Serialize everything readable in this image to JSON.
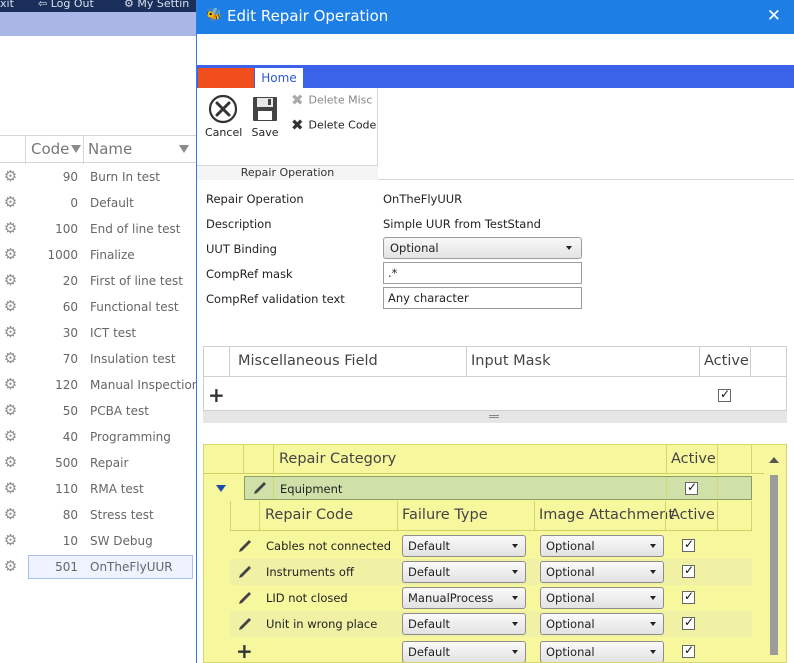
{
  "background": {
    "topbar": {
      "exit": "xit",
      "logout": "Log Out",
      "settings": "My Settin"
    },
    "grid": {
      "col_code": "Code",
      "col_name": "Name",
      "rows": [
        {
          "code": "90",
          "name": "Burn In test"
        },
        {
          "code": "0",
          "name": "Default"
        },
        {
          "code": "100",
          "name": "End of line test"
        },
        {
          "code": "1000",
          "name": "Finalize"
        },
        {
          "code": "20",
          "name": "First of line test"
        },
        {
          "code": "60",
          "name": "Functional test"
        },
        {
          "code": "30",
          "name": "ICT test"
        },
        {
          "code": "70",
          "name": "Insulation test"
        },
        {
          "code": "120",
          "name": "Manual Inspection"
        },
        {
          "code": "50",
          "name": "PCBA test"
        },
        {
          "code": "40",
          "name": "Programming"
        },
        {
          "code": "500",
          "name": "Repair"
        },
        {
          "code": "110",
          "name": "RMA test"
        },
        {
          "code": "80",
          "name": "Stress test"
        },
        {
          "code": "10",
          "name": "SW Debug"
        },
        {
          "code": "501",
          "name": "OnTheFlyUUR"
        }
      ]
    }
  },
  "dialog": {
    "title": "Edit Repair Operation",
    "close_symbol": "✕",
    "ribbon": {
      "tab_home": "Home",
      "cancel": "Cancel",
      "save": "Save",
      "delete_misc": "Delete Misc",
      "delete_code": "Delete Code",
      "group_label": "Repair Operation"
    },
    "form": {
      "repair_operation_label": "Repair Operation",
      "repair_operation_value": "OnTheFlyUUR",
      "description_label": "Description",
      "description_value": "Simple UUR from TestStand",
      "uut_binding_label": "UUT Binding",
      "uut_binding_value": "Optional",
      "compref_mask_label": "CompRef mask",
      "compref_mask_value": ".*",
      "compref_validation_label": "CompRef validation text",
      "compref_validation_value": "Any character"
    },
    "misc_grid": {
      "col_field": "Miscellaneous Field",
      "col_mask": "Input Mask",
      "col_active": "Active",
      "new_row_active": true
    },
    "category_grid": {
      "col_category": "Repair Category",
      "col_active": "Active",
      "category": {
        "name": "Equipment",
        "active": true
      },
      "sub_headers": {
        "repair_code": "Repair Code",
        "failure_type": "Failure Type",
        "image_attachment": "Image Attachment",
        "active": "Active"
      },
      "codes": [
        {
          "name": "Cables not connected",
          "failure": "Default",
          "image": "Optional",
          "active": true
        },
        {
          "name": "Instruments off",
          "failure": "Default",
          "image": "Optional",
          "active": true
        },
        {
          "name": "LID not closed",
          "failure": "ManualProcess",
          "image": "Optional",
          "active": true
        },
        {
          "name": "Unit in wrong place",
          "failure": "Default",
          "image": "Optional",
          "active": true
        }
      ],
      "new_row": {
        "failure": "Default",
        "image": "Optional",
        "active": true
      }
    }
  }
}
